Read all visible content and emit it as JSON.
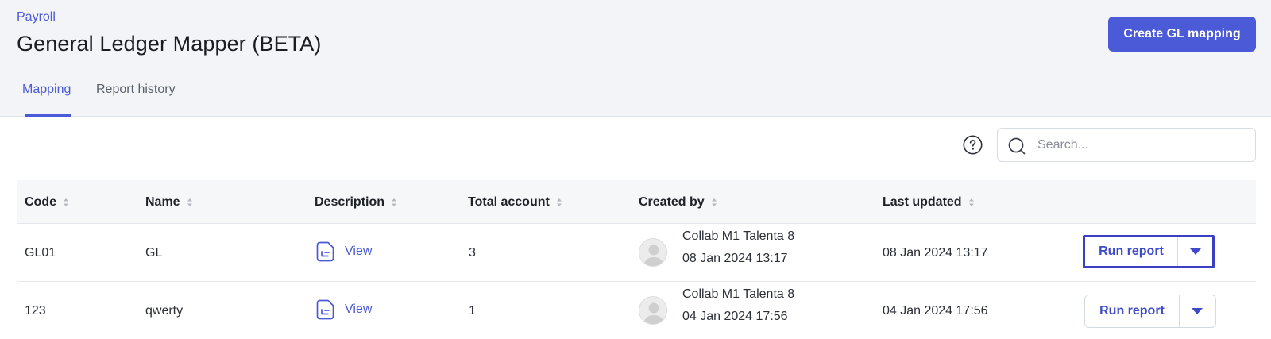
{
  "header": {
    "breadcrumb": "Payroll",
    "title": "General Ledger Mapper (BETA)",
    "create_button": "Create GL mapping"
  },
  "tabs": [
    {
      "label": "Mapping",
      "active": true
    },
    {
      "label": "Report history",
      "active": false
    }
  ],
  "toolbar": {
    "help_icon": "question-circle-icon",
    "search_placeholder": "Search...",
    "search_value": ""
  },
  "table": {
    "columns": [
      "Code",
      "Name",
      "Description",
      "Total account",
      "Created by",
      "Last updated"
    ],
    "rows": [
      {
        "code": "GL01",
        "name": "GL",
        "description_link": "View",
        "total_account": "3",
        "created_by_name": "Collab M1 Talenta 8",
        "created_by_date": "08 Jan 2024 13:17",
        "last_updated": "08 Jan 2024 13:17",
        "action_label": "Run report",
        "focused": true
      },
      {
        "code": "123",
        "name": "qwerty",
        "description_link": "View",
        "total_account": "1",
        "created_by_name": "Collab M1 Talenta 8",
        "created_by_date": "04 Jan 2024 17:56",
        "last_updated": "04 Jan 2024 17:56",
        "action_label": "Run report",
        "focused": false
      }
    ]
  },
  "colors": {
    "accent": "#4b5ad6",
    "focus_ring": "#3b3fc4",
    "header_bg": "#f2f4f8"
  }
}
